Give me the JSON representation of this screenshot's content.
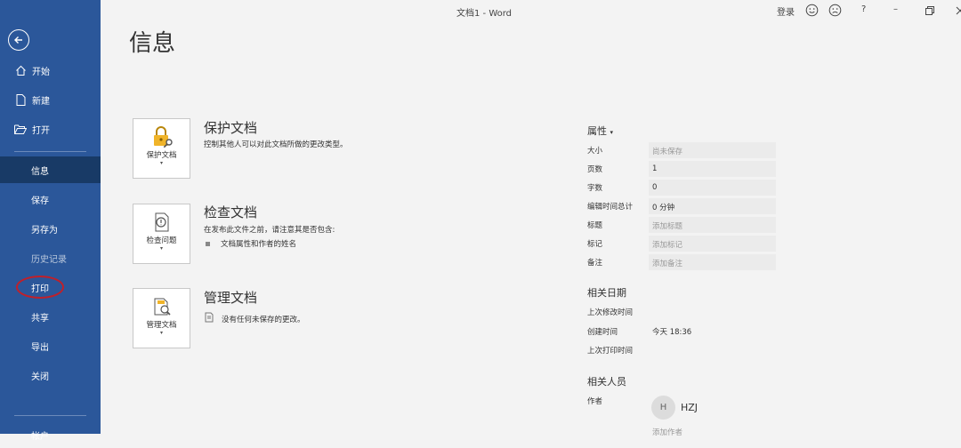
{
  "window": {
    "doc_title": "文档1  -  Word",
    "signin": "登录",
    "help": "?",
    "minimize": "–"
  },
  "sidebar": {
    "items": [
      {
        "label": "开始"
      },
      {
        "label": "新建"
      },
      {
        "label": "打开"
      },
      {
        "label": "信息"
      },
      {
        "label": "保存"
      },
      {
        "label": "另存为"
      },
      {
        "label": "历史记录"
      },
      {
        "label": "打印"
      },
      {
        "label": "共享"
      },
      {
        "label": "导出"
      },
      {
        "label": "关闭"
      }
    ],
    "bottom_partial": "帐户"
  },
  "page": {
    "title": "信息"
  },
  "sections": {
    "protect": {
      "button_label": "保护文档",
      "title": "保护文档",
      "desc": "控制其他人可以对此文档所做的更改类型。"
    },
    "inspect": {
      "button_label": "检查问题",
      "title": "检查文档",
      "desc": "在发布此文件之前，请注意其是否包含:",
      "bullet": "文档属性和作者的姓名"
    },
    "manage": {
      "button_label": "管理文档",
      "title": "管理文档",
      "desc": "没有任何未保存的更改。"
    }
  },
  "properties": {
    "header": "属性",
    "rows": [
      {
        "label": "大小",
        "value": "尚未保存"
      },
      {
        "label": "页数",
        "value": "1"
      },
      {
        "label": "字数",
        "value": "0"
      },
      {
        "label": "编辑时间总计",
        "value": "0 分钟"
      },
      {
        "label": "标题",
        "value": "添加标题"
      },
      {
        "label": "标记",
        "value": "添加标记"
      },
      {
        "label": "备注",
        "value": "添加备注"
      }
    ]
  },
  "dates": {
    "header": "相关日期",
    "rows": [
      {
        "label": "上次修改时间",
        "value": ""
      },
      {
        "label": "创建时间",
        "value": "今天 18:36"
      },
      {
        "label": "上次打印时间",
        "value": ""
      }
    ]
  },
  "people": {
    "header": "相关人员",
    "author_label": "作者",
    "author_initial": "H",
    "author_name": "HZJ",
    "add_author": "添加作者"
  },
  "colors": {
    "sidebar_bg": "#2b579a",
    "sidebar_active": "#183a66",
    "annotation": "#c0202a"
  }
}
